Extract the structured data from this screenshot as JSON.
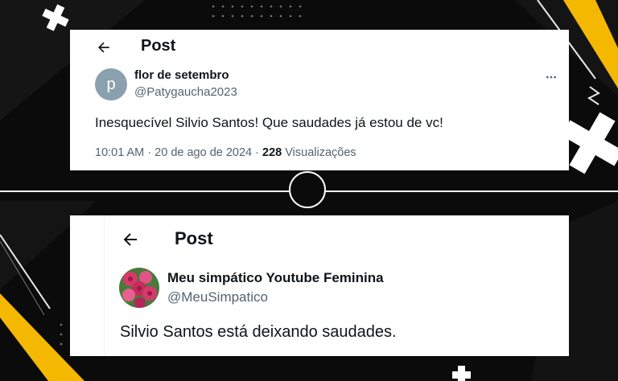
{
  "top_post": {
    "header_title": "Post",
    "avatar_letter": "p",
    "display_name": "flor de setembro",
    "handle": "@Patygaucha2023",
    "text": "Inesquecível Silvio Santos! Que saudades já estou de vc!",
    "time": "10:01 AM",
    "date": "20 de ago de 2024",
    "view_count": "228",
    "view_label": "Visualizações",
    "sep": "·"
  },
  "bottom_post": {
    "header_title": "Post",
    "display_name": "Meu simpático Youtube Feminina",
    "handle": "@MeuSimpatico",
    "text": "Silvio Santos está deixando saudades."
  },
  "colors": {
    "accent_yellow": "#f5b800",
    "background": "#0b0b0b",
    "card": "#ffffff",
    "secondary_text": "#536471"
  },
  "icons": [
    "back-arrow-icon",
    "more-options-icon",
    "plus-icon"
  ]
}
